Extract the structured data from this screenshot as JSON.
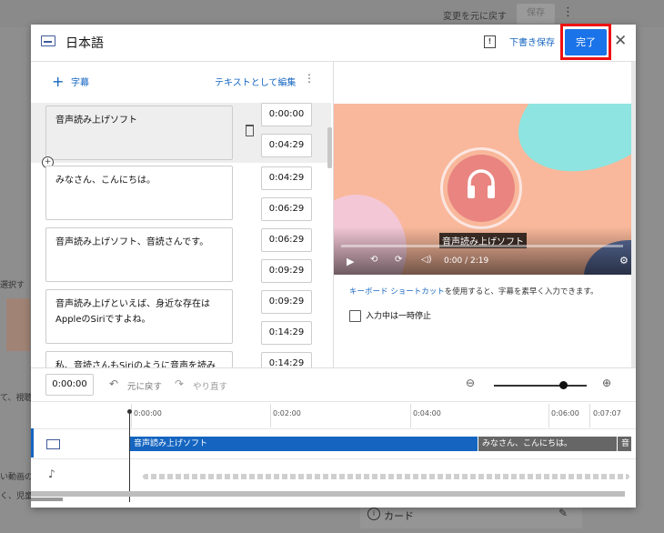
{
  "background": {
    "undo_label": "変更を元に戻す",
    "save_label": "保存",
    "left_text_1": "選択す",
    "left_text_2": "て、視聴",
    "left_text_3": "い動画の",
    "left_text_4": "く、児童",
    "card_label": "カード"
  },
  "dialog": {
    "title": "日本語",
    "draft_label": "下書き保存",
    "done_label": "完了"
  },
  "captions_panel": {
    "add_label": "字幕",
    "edit_as_text": "テキストとして編集",
    "rows": [
      {
        "text": "音声読み上げソフト",
        "start": "0:00:00",
        "end": "0:04:29"
      },
      {
        "text": "みなさん、こんにちは。",
        "start": "0:04:29",
        "end": "0:06:29"
      },
      {
        "text": "音声読み上げソフト、音読さんです。",
        "start": "0:06:29",
        "end": "0:09:29"
      },
      {
        "text": "音声読み上げといえば、身近な存在はAppleのSiriですよね。",
        "start": "0:09:29",
        "end": "0:14:29"
      },
      {
        "text": "私、音読さんもSiriのように音声を読み",
        "start": "0:14:29",
        "end": ""
      }
    ]
  },
  "video": {
    "caption": "音声読み上げソフト",
    "time": "0:00 / 2:19"
  },
  "shortcuts": {
    "link": "キーボード ショートカット",
    "rest": "を使用すると、字幕を素早く入力できます。",
    "pause_label": "入力中は一時停止"
  },
  "timeline": {
    "current_time": "0:00:00",
    "undo": "元に戻す",
    "redo": "やり直す",
    "ticks": [
      "0:00:00",
      "0:02:00",
      "0:04:00",
      "0:06:00",
      "0:07:07"
    ],
    "segments": [
      "音声読み上げソフト",
      "みなさん、こんにちは。",
      "音"
    ]
  }
}
